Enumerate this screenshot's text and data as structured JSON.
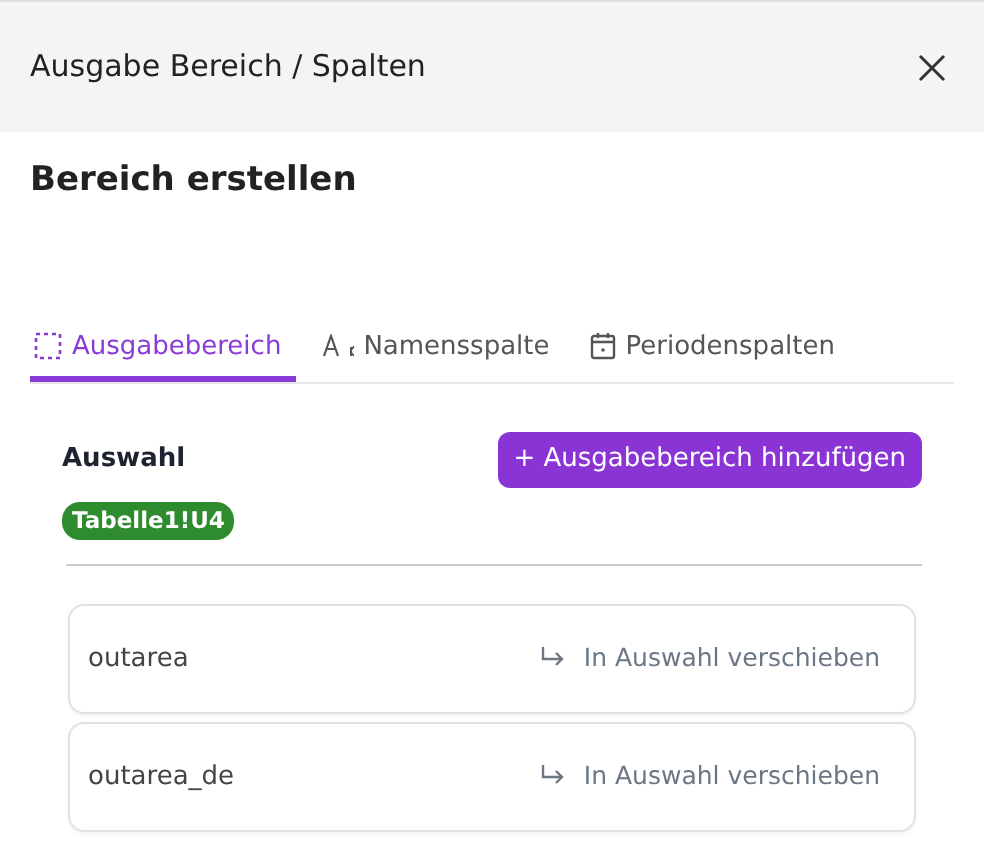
{
  "dialog": {
    "title": "Ausgabe Bereich / Spalten"
  },
  "heading": "Bereich erstellen",
  "tabs": [
    {
      "label": "Ausgabebereich",
      "kind": "area",
      "selected": true
    },
    {
      "label": "Namensspalte",
      "kind": "text",
      "selected": false
    },
    {
      "label": "Periodenspalten",
      "kind": "calendar",
      "selected": false
    }
  ],
  "selection": {
    "label": "Auswahl",
    "add_button": "+ Ausgabebereich hinzufügen",
    "tags": [
      {
        "label": "Tabelle1!U4",
        "color": "#2e8b2e"
      }
    ]
  },
  "items": [
    {
      "name": "outarea",
      "action": "In Auswahl verschieben"
    },
    {
      "name": "outarea_de",
      "action": "In Auswahl verschieben"
    }
  ]
}
